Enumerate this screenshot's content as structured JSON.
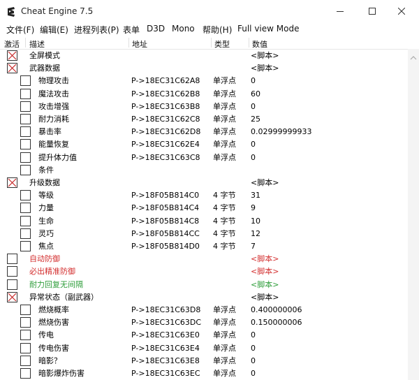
{
  "window": {
    "title": "Cheat Engine 7.5"
  },
  "menu": [
    "文件(F)",
    "编辑(E)",
    "进程列表(P)",
    "表单",
    "D3D",
    "Mono",
    "帮助(H)",
    "Full view Mode"
  ],
  "columns": {
    "active": "激活",
    "desc": "描述",
    "address": "地址",
    "type": "类型",
    "value": "数值"
  },
  "colors": {
    "red_script": "#d32f2f",
    "green_script": "#2e9d3a",
    "check_red": "#c62828"
  },
  "rows": [
    {
      "indent": 0,
      "checked": true,
      "desc": "全屏模式",
      "address": "",
      "type": "",
      "value": "<脚本>",
      "color": "#000000"
    },
    {
      "indent": 0,
      "checked": true,
      "desc": "武器数据",
      "address": "",
      "type": "",
      "value": "<脚本>",
      "color": "#000000"
    },
    {
      "indent": 1,
      "checked": false,
      "desc": "物理攻击",
      "address": "P->18EC31C62A8",
      "type": "单浮点",
      "value": "0",
      "color": "#000000"
    },
    {
      "indent": 1,
      "checked": false,
      "desc": "魔法攻击",
      "address": "P->18EC31C62B8",
      "type": "单浮点",
      "value": "60",
      "color": "#000000"
    },
    {
      "indent": 1,
      "checked": false,
      "desc": "攻击增强",
      "address": "P->18EC31C63B8",
      "type": "单浮点",
      "value": "0",
      "color": "#000000"
    },
    {
      "indent": 1,
      "checked": false,
      "desc": "耐力消耗",
      "address": "P->18EC31C62C8",
      "type": "单浮点",
      "value": "25",
      "color": "#000000"
    },
    {
      "indent": 1,
      "checked": false,
      "desc": "暴击率",
      "address": "P->18EC31C62D8",
      "type": "单浮点",
      "value": "0.02999999933",
      "color": "#000000"
    },
    {
      "indent": 1,
      "checked": false,
      "desc": "能量恢复",
      "address": "P->18EC31C62E4",
      "type": "单浮点",
      "value": "0",
      "color": "#000000"
    },
    {
      "indent": 1,
      "checked": false,
      "desc": "提升体力值",
      "address": "P->18EC31C63C8",
      "type": "单浮点",
      "value": "0",
      "color": "#000000"
    },
    {
      "indent": 1,
      "checked": false,
      "desc": "条件",
      "address": "",
      "type": "",
      "value": "",
      "color": "#000000"
    },
    {
      "indent": 0,
      "checked": true,
      "desc": "升级数据",
      "address": "",
      "type": "",
      "value": "<脚本>",
      "color": "#000000"
    },
    {
      "indent": 1,
      "checked": false,
      "desc": "等级",
      "address": "P->18F05B814C0",
      "type": "4 字节",
      "value": "31",
      "color": "#000000"
    },
    {
      "indent": 1,
      "checked": false,
      "desc": "力量",
      "address": "P->18F05B814C4",
      "type": "4 字节",
      "value": "9",
      "color": "#000000"
    },
    {
      "indent": 1,
      "checked": false,
      "desc": "生命",
      "address": "P->18F05B814C8",
      "type": "4 字节",
      "value": "10",
      "color": "#000000"
    },
    {
      "indent": 1,
      "checked": false,
      "desc": "灵巧",
      "address": "P->18F05B814CC",
      "type": "4 字节",
      "value": "12",
      "color": "#000000"
    },
    {
      "indent": 1,
      "checked": false,
      "desc": "焦点",
      "address": "P->18F05B814D0",
      "type": "4 字节",
      "value": "7",
      "color": "#000000"
    },
    {
      "indent": 0,
      "checked": false,
      "desc": "自动防御",
      "address": "",
      "type": "",
      "value": "<脚本>",
      "color": "#d32f2f"
    },
    {
      "indent": 0,
      "checked": false,
      "desc": "必出精准防御",
      "address": "",
      "type": "",
      "value": "<脚本>",
      "color": "#d32f2f"
    },
    {
      "indent": 0,
      "checked": false,
      "desc": "耐力回复无间隔",
      "address": "",
      "type": "",
      "value": "<脚本>",
      "color": "#2e9d3a"
    },
    {
      "indent": 0,
      "checked": true,
      "desc": "异常状态（副武器）",
      "address": "",
      "type": "",
      "value": "<脚本>",
      "color": "#000000"
    },
    {
      "indent": 1,
      "checked": false,
      "desc": "燃烧概率",
      "address": "P->18EC31C63D8",
      "type": "单浮点",
      "value": "0.400000006",
      "color": "#000000"
    },
    {
      "indent": 1,
      "checked": false,
      "desc": "燃烧伤害",
      "address": "P->18EC31C63DC",
      "type": "单浮点",
      "value": "0.150000006",
      "color": "#000000"
    },
    {
      "indent": 1,
      "checked": false,
      "desc": "传电",
      "address": "P->18EC31C63E0",
      "type": "单浮点",
      "value": "0",
      "color": "#000000"
    },
    {
      "indent": 1,
      "checked": false,
      "desc": "传电伤害",
      "address": "P->18EC31C63E4",
      "type": "单浮点",
      "value": "0",
      "color": "#000000"
    },
    {
      "indent": 1,
      "checked": false,
      "desc": "暗影？",
      "address": "P->18EC31C63E8",
      "type": "单浮点",
      "value": "0",
      "color": "#000000"
    },
    {
      "indent": 1,
      "checked": false,
      "desc": "暗影爆炸伤害",
      "address": "P->18EC31C63EC",
      "type": "单浮点",
      "value": "0",
      "color": "#000000"
    }
  ]
}
